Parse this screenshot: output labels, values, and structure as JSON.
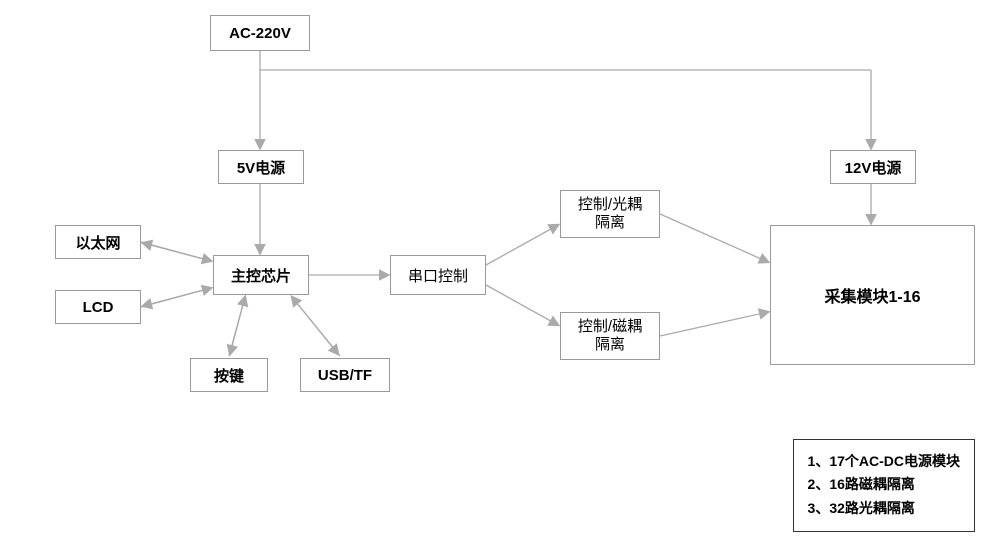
{
  "boxes": {
    "ac220v": "AC-220V",
    "psu5v": "5V电源",
    "psu12v": "12V电源",
    "ethernet": "以太网",
    "lcd": "LCD",
    "mcu": "主控芯片",
    "serial": "串口控制",
    "keys": "按键",
    "usbtf": "USB/TF",
    "ctrl_opto": "控制/光耦\n隔离",
    "ctrl_mag": "控制/磁耦\n隔离",
    "daq": "采集模块1-16"
  },
  "legend": {
    "line1": "1、17个AC-DC电源模块",
    "line2": "2、16路磁耦隔离",
    "line3": "3、32路光耦隔离"
  }
}
